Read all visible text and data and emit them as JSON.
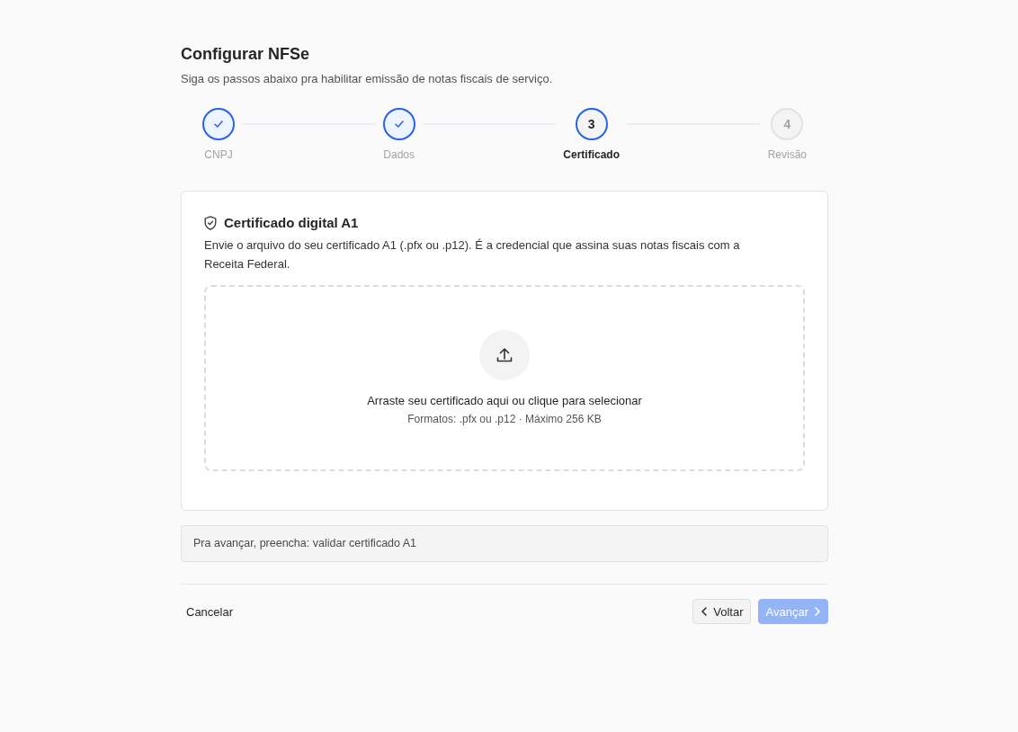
{
  "header": {
    "title": "Configurar NFSe",
    "subtitle": "Siga os passos abaixo pra habilitar emissão de notas fiscais de serviço."
  },
  "stepper": [
    {
      "label": "CNPJ",
      "completed": true,
      "selected": false
    },
    {
      "label": "Dados",
      "completed": true,
      "selected": false
    },
    {
      "number": "3",
      "label": "Certificado",
      "completed": false,
      "selected": true
    },
    {
      "number": "4",
      "label": "Revisão",
      "completed": false,
      "selected": false
    }
  ],
  "certificate_card": {
    "title": "Certificado digital A1",
    "description": "Envie o arquivo do seu certificado A1 (.pfx ou .p12). É a credencial que assina suas notas fiscais com a Receita Federal.",
    "dropzone": {
      "prompt": "Arraste seu certificado aqui ou clique para selecionar",
      "hint": "Formatos: .pfx ou .p12 · Máximo 256 KB"
    }
  },
  "notice": "Pra avançar, preencha: validar certificado A1",
  "footer": {
    "cancel": "Cancelar",
    "back": {
      "label": "Voltar",
      "disabled": false
    },
    "next": {
      "label": "Avançar",
      "disabled": true
    }
  }
}
